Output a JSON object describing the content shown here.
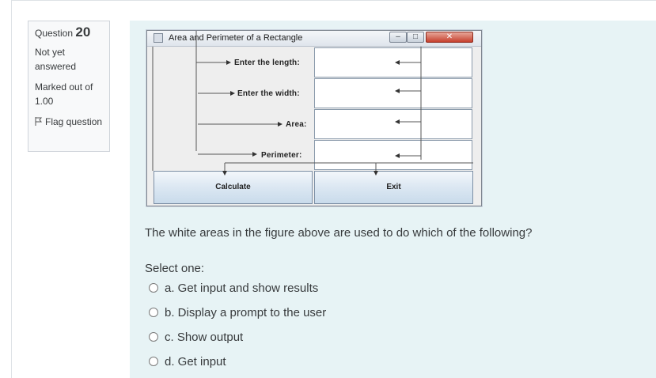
{
  "question_info": {
    "label": "Question",
    "number": "20",
    "state": "Not yet answered",
    "grade": "Marked out of 1.00",
    "flag_label": "Flag question"
  },
  "figure": {
    "window_title": "Area and Perimeter of a Rectangle",
    "window_buttons": [
      "minimize",
      "maximize",
      "close"
    ],
    "labels": {
      "length": "Enter the length:",
      "width": "Enter the width:",
      "area": "Area:",
      "perimeter": "Perimeter:"
    },
    "buttons": {
      "calculate": "Calculate",
      "exit": "Exit"
    }
  },
  "question_text": "The white areas in the figure above are used to do which of the following?",
  "prompt": "Select one:",
  "options": [
    "a. Get input and show results",
    "b. Display a prompt to the user",
    "c. Show output",
    "d. Get input"
  ]
}
